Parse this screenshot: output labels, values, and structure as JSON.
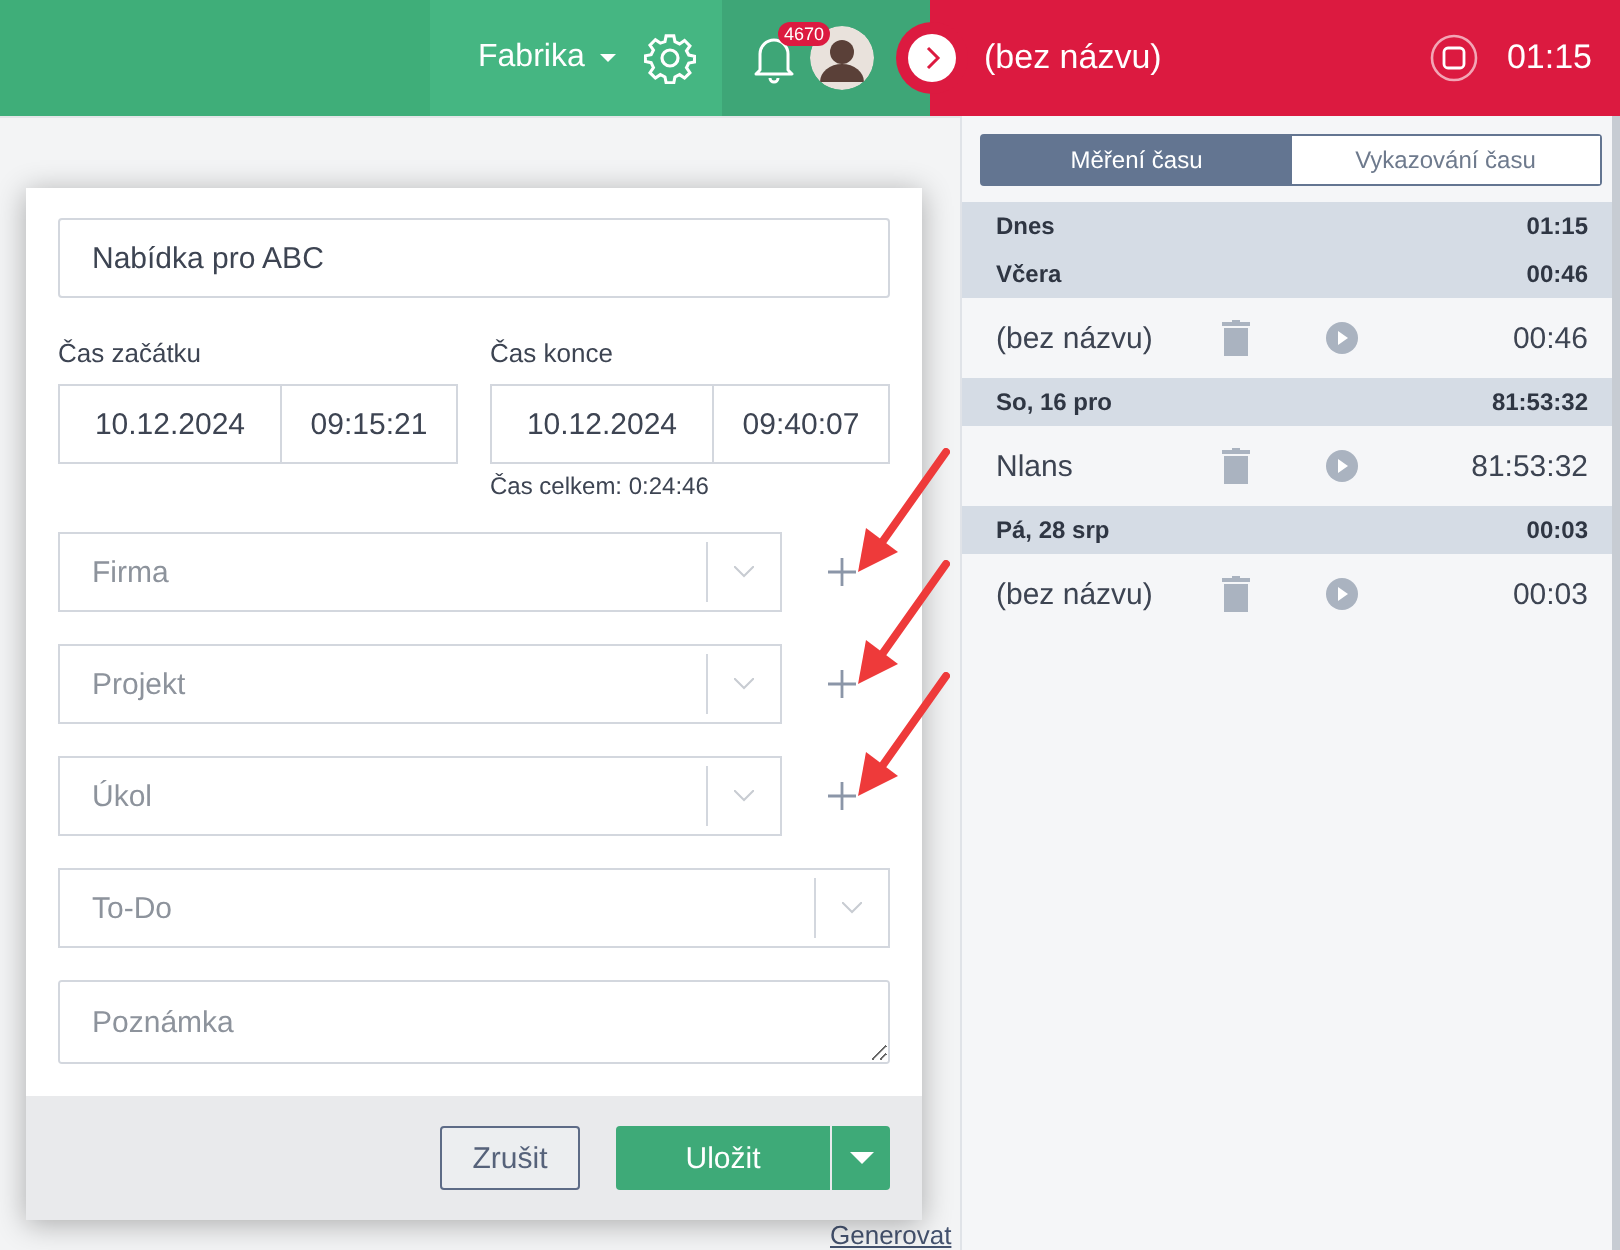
{
  "topbar": {
    "workspace": "Fabrika",
    "notifications": "4670",
    "timer": {
      "title": "(bez názvu)",
      "time": "01:15"
    }
  },
  "dialog": {
    "name_value": "Nabídka pro ABC",
    "start": {
      "label": "Čas začátku",
      "date": "10.12.2024",
      "time": "09:15:21"
    },
    "end": {
      "label": "Čas konce",
      "date": "10.12.2024",
      "time": "09:40:07"
    },
    "total": "Čas celkem: 0:24:46",
    "selects": [
      {
        "placeholder": "Firma",
        "addable": true
      },
      {
        "placeholder": "Projekt",
        "addable": true
      },
      {
        "placeholder": "Úkol",
        "addable": true
      },
      {
        "placeholder": "To-Do",
        "addable": false
      }
    ],
    "note": {
      "placeholder": "Poznámka"
    },
    "cancel": "Zrušit",
    "save": "Uložit"
  },
  "background_link": "Generovat",
  "panel": {
    "tabs": [
      {
        "label": "Měření času",
        "selected": true
      },
      {
        "label": "Vykazování času",
        "selected": false
      }
    ],
    "days": [
      {
        "label": "Dnes",
        "total": "01:15"
      },
      {
        "label": "Včera",
        "total": "00:46",
        "entries": [
          {
            "title": "(bez názvu)",
            "time": "00:46"
          }
        ]
      },
      {
        "label": "So, 16 pro",
        "total": "81:53:32",
        "entries": [
          {
            "title": "Nlans",
            "time": "81:53:32"
          }
        ]
      },
      {
        "label": "Pá, 28 srp",
        "total": "00:03",
        "entries": [
          {
            "title": "(bez názvu)",
            "time": "00:03"
          }
        ]
      }
    ]
  }
}
